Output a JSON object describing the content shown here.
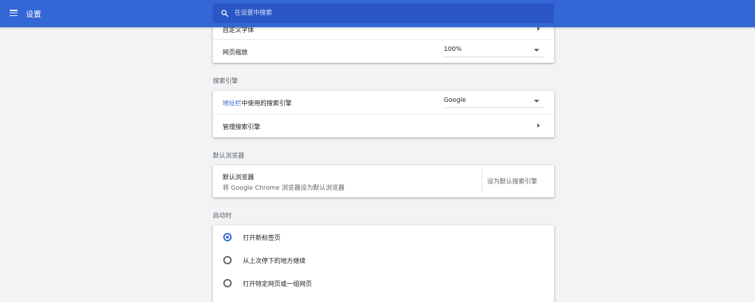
{
  "header": {
    "title": "设置",
    "search_placeholder": "在设置中搜索"
  },
  "appearance": {
    "custom_fonts_label": "自定义字体",
    "zoom_label": "网页缩放",
    "zoom_value": "100%"
  },
  "search_engine": {
    "section_title": "搜索引擎",
    "address_bar_link": "地址栏",
    "address_bar_label_rest": "中使用的搜索引擎",
    "engine_value": "Google",
    "manage_label": "管理搜索引擎"
  },
  "default_browser": {
    "section_title": "默认浏览器",
    "title": "默认浏览器",
    "subtitle": "将 Google Chrome 浏览器设为默认浏览器",
    "button_label": "设为默认搜索引擎"
  },
  "startup": {
    "section_title": "启动时",
    "options": [
      {
        "label": "打开新标签页",
        "checked": true
      },
      {
        "label": "从上次停下的地方继续",
        "checked": false
      },
      {
        "label": "打开特定网页或一组网页",
        "checked": false
      }
    ]
  },
  "colors": {
    "accent": "#3367d6",
    "toolbar": "#3367d6",
    "background": "#f1f3f4"
  }
}
